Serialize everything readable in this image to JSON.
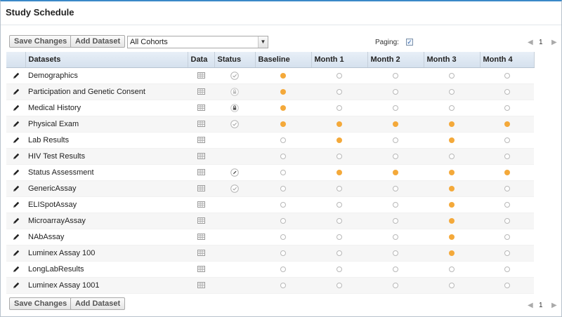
{
  "panel": {
    "title": "Study Schedule"
  },
  "toolbar": {
    "save_label": "Save Changes",
    "add_label": "Add Dataset",
    "cohort_value": "All Cohorts",
    "paging_label": "Paging:",
    "paging_checked": true,
    "page": "1"
  },
  "table": {
    "columns": [
      "Datasets",
      "Data",
      "Status",
      "Baseline",
      "Month 1",
      "Month 2",
      "Month 3",
      "Month 4"
    ],
    "rows": [
      {
        "name": "Demographics",
        "status": "check",
        "timepoints": [
          1,
          0,
          0,
          0,
          0
        ]
      },
      {
        "name": "Participation and Genetic Consent",
        "status": "lock",
        "timepoints": [
          1,
          0,
          0,
          0,
          0
        ]
      },
      {
        "name": "Medical History",
        "status": "lock-dark",
        "timepoints": [
          1,
          0,
          0,
          0,
          0
        ]
      },
      {
        "name": "Physical Exam",
        "status": "check",
        "timepoints": [
          1,
          1,
          1,
          1,
          1
        ]
      },
      {
        "name": "Lab Results",
        "status": "",
        "timepoints": [
          0,
          1,
          0,
          1,
          0
        ]
      },
      {
        "name": "HIV Test Results",
        "status": "",
        "timepoints": [
          0,
          0,
          0,
          0,
          0
        ]
      },
      {
        "name": "Status Assessment",
        "status": "edit",
        "timepoints": [
          0,
          1,
          1,
          1,
          1
        ]
      },
      {
        "name": "GenericAssay",
        "status": "check",
        "timepoints": [
          0,
          0,
          0,
          1,
          0
        ]
      },
      {
        "name": "ELISpotAssay",
        "status": "",
        "timepoints": [
          0,
          0,
          0,
          1,
          0
        ]
      },
      {
        "name": "MicroarrayAssay",
        "status": "",
        "timepoints": [
          0,
          0,
          0,
          1,
          0
        ]
      },
      {
        "name": "NAbAssay",
        "status": "",
        "timepoints": [
          0,
          0,
          0,
          1,
          0
        ]
      },
      {
        "name": "Luminex Assay 100",
        "status": "",
        "timepoints": [
          0,
          0,
          0,
          1,
          0
        ]
      },
      {
        "name": "LongLabResults",
        "status": "",
        "timepoints": [
          0,
          0,
          0,
          0,
          0
        ]
      },
      {
        "name": "Luminex Assay 1001",
        "status": "",
        "timepoints": [
          0,
          0,
          0,
          0,
          0
        ]
      }
    ]
  },
  "colors": {
    "dot_on": "#f4a93a",
    "dot_off_border": "#b8b8b8",
    "header_accent": "#3a88c8"
  },
  "icons": {
    "edit": "pencil-icon",
    "data": "grid-icon",
    "status_check": "check-circle-icon",
    "status_lock": "lock-icon",
    "status_edit": "edit-circle-icon"
  }
}
